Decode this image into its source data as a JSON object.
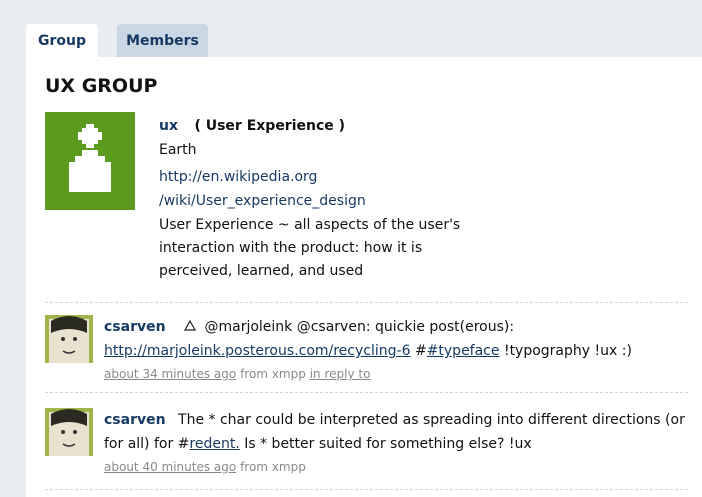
{
  "tabs": [
    {
      "label": "Group",
      "active": true
    },
    {
      "label": "Members",
      "active": false
    }
  ],
  "page": {
    "title": "UX GROUP"
  },
  "group": {
    "nickname": "ux",
    "fullname": "( User Experience )",
    "location": "Earth",
    "url_line1": "http://en.wikipedia.org",
    "url_line2": "/wiki/User_experience_design",
    "description_lines": [
      "User Experience ~ all aspects of the user's",
      "interaction with the product: how it is",
      "perceived, learned, and used"
    ],
    "logo_color": "#5c9a1e"
  },
  "notices": [
    {
      "author": "csarven",
      "line1_pre": "@marjoleink @csarven: quickie post(erous):",
      "link": "http://marjoleink.posterous.com/recycling-6",
      "tag": "#typeface",
      "line2_post": "!typography !ux :)",
      "time": "about 34 minutes ago",
      "from": "from",
      "source": "xmpp",
      "reply": "in reply to"
    },
    {
      "author": "csarven",
      "line1": "The * char could be interpreted as spreading into different directions (or",
      "line2_pre": "for all) for #",
      "tag": "redent.",
      "line2_post": "Is * better suited for something else? !ux",
      "time": "about 40 minutes ago",
      "from": "from",
      "source": "xmpp"
    }
  ],
  "colors": {
    "link": "#163a63",
    "tab_inactive": "#c9d6e3",
    "page_bg": "#e9edf2"
  }
}
